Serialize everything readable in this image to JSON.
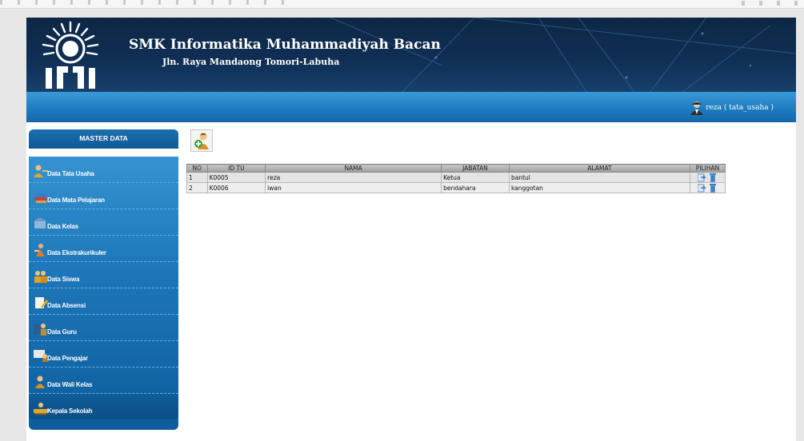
{
  "school": {
    "name": "SMK Informatika Muhammadiyah Bacan",
    "address": "Jln. Raya Mandaong Tomori-Labuha"
  },
  "user": {
    "label": "reza ( tata_usaha )"
  },
  "sidebar": {
    "title": "MASTER DATA",
    "items": [
      {
        "label": "Data Tata Usaha",
        "icon": "user-key-icon"
      },
      {
        "label": "Data Mata Pelajaran",
        "icon": "books-icon"
      },
      {
        "label": "Data Kelas",
        "icon": "building-icon"
      },
      {
        "label": "Data Ekstrakurikuler",
        "icon": "sport-icon"
      },
      {
        "label": "Data Siswa",
        "icon": "students-icon"
      },
      {
        "label": "Data Absensi",
        "icon": "document-pen-icon"
      },
      {
        "label": "Data Guru",
        "icon": "teacher-icon"
      },
      {
        "label": "Data Pengajar",
        "icon": "teaching-icon"
      },
      {
        "label": "Data Wali Kelas",
        "icon": "guardian-icon"
      },
      {
        "label": "Kepala Sekolah",
        "icon": "principal-icon"
      }
    ]
  },
  "table": {
    "headers": [
      "NO",
      "ID TU",
      "NAMA",
      "JABATAN",
      "ALAMAT",
      "PILIHAN"
    ],
    "rows": [
      {
        "no": "1",
        "id": "K0005",
        "nama": "reza",
        "jabatan": "Ketua",
        "alamat": "bantul"
      },
      {
        "no": "2",
        "id": "K0006",
        "nama": "iwan",
        "jabatan": "bendahara",
        "alamat": "kanggotan"
      }
    ]
  },
  "colors": {
    "header_dark": "#0d2745",
    "bar_blue": "#1f7cc0",
    "sidebar_blue": "#1e78bb"
  }
}
